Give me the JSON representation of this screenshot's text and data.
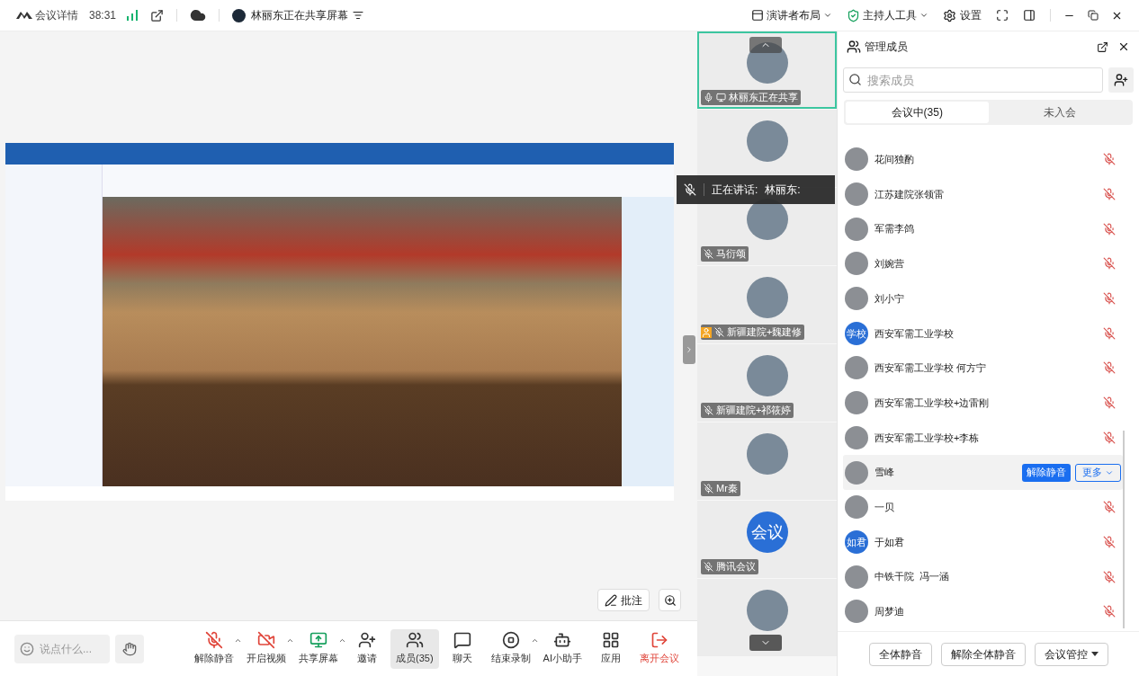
{
  "top_bar": {
    "title": "会议详情",
    "duration": "38:31",
    "sharing_status": "林丽东正在共享屏幕",
    "layout_menu": "演讲者布局",
    "host_tools": "主持人工具",
    "settings": "设置"
  },
  "shared_screen": {
    "annotate_button": "批注"
  },
  "speaking_tooltip": {
    "label": "正在讲话:",
    "speaker": "林丽东:"
  },
  "video_tiles": [
    {
      "kind": "sharing",
      "name": "林丽东正在共享",
      "selected": true
    },
    {
      "kind": "covered",
      "selected": false
    },
    {
      "kind": "normal",
      "name": "马衍颂",
      "selected": false
    },
    {
      "kind": "host",
      "name": "新疆建院+魏建修",
      "selected": false
    },
    {
      "kind": "normal",
      "name": "新疆建院+祁筱婷",
      "selected": false
    },
    {
      "kind": "normal",
      "name": "Mr秦",
      "selected": false
    },
    {
      "kind": "normal",
      "name": "腾讯会议",
      "avatar_text": "会议",
      "selected": false
    },
    {
      "kind": "covered",
      "selected": false
    }
  ],
  "members_panel": {
    "title": "管理成员",
    "search": {
      "placeholder": "搜索成员"
    },
    "tabs": [
      {
        "label": "会议中(35)",
        "selected": true
      },
      {
        "label": "未入会",
        "selected": false
      }
    ],
    "members": [
      {
        "name": "花间独酌",
        "muted": true,
        "highlighted": false
      },
      {
        "name": "江苏建院张领雷",
        "muted": true,
        "highlighted": false
      },
      {
        "name": "军需李鸽",
        "muted": true,
        "highlighted": false
      },
      {
        "name": "刘婉营",
        "muted": true,
        "highlighted": false
      },
      {
        "name": "刘小宁",
        "muted": true,
        "highlighted": false
      },
      {
        "name": "西安军需工业学校",
        "avatar_text": "学校",
        "muted": true,
        "highlighted": false
      },
      {
        "name": "西安军需工业学校 何方宁",
        "muted": true,
        "highlighted": false
      },
      {
        "name": "西安军需工业学校+边雷刚",
        "muted": true,
        "highlighted": false
      },
      {
        "name": "西安军需工业学校+李栋",
        "muted": true,
        "highlighted": false
      },
      {
        "name": "雪峰",
        "highlighted": true,
        "actions": [
          "解除静音",
          "更多"
        ]
      },
      {
        "name": "一贝",
        "muted": true,
        "highlighted": false
      },
      {
        "name": "于如君",
        "avatar_text": "如君",
        "muted": true,
        "highlighted": false
      },
      {
        "name": "中铁干院  冯一涵",
        "muted": true,
        "highlighted": false
      },
      {
        "name": "周梦迪",
        "muted": true,
        "highlighted": false
      }
    ],
    "footer_buttons": [
      "全体静音",
      "解除全体静音",
      "会议管控"
    ]
  },
  "toolbar": {
    "chat_input": {
      "placeholder": "说点什么..."
    },
    "items": [
      {
        "kind": "mic_off",
        "label": "解除静音",
        "has_menu": true,
        "selected": false
      },
      {
        "kind": "video_off",
        "label": "开启视频",
        "has_menu": true,
        "selected": false
      },
      {
        "kind": "share",
        "label": "共享屏幕",
        "has_menu": true,
        "selected": false
      },
      {
        "kind": "invite",
        "label": "邀请",
        "has_menu": false,
        "selected": false
      },
      {
        "kind": "members",
        "label": "成员(35)",
        "has_menu": false,
        "selected": true
      },
      {
        "kind": "chat",
        "label": "聊天",
        "has_menu": false,
        "selected": false
      },
      {
        "kind": "record",
        "label": "结束录制",
        "has_menu": true,
        "selected": false
      },
      {
        "kind": "assistant",
        "label": "AI小助手",
        "has_menu": false,
        "selected": false
      },
      {
        "kind": "apps",
        "label": "应用",
        "has_menu": false,
        "selected": false
      }
    ],
    "leave_button": "离开会议"
  }
}
